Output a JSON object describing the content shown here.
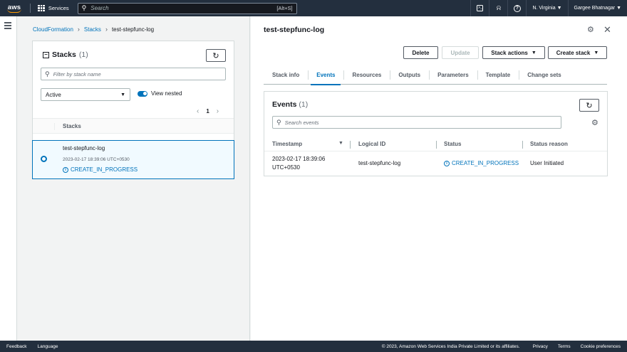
{
  "topnav": {
    "logo": "aws",
    "services_label": "Services",
    "search_placeholder": "Search",
    "search_shortcut": "[Alt+S]",
    "region": "N. Virginia",
    "user": "Gargee Bhatnagar",
    "icons": [
      "cloudshell-icon",
      "notifications-icon",
      "help-icon"
    ]
  },
  "breadcrumb": {
    "items": [
      "CloudFormation",
      "Stacks",
      "test-stepfunc-log"
    ]
  },
  "stacks_panel": {
    "title": "Stacks",
    "count": "(1)",
    "filter_placeholder": "Filter by stack name",
    "status_filter": "Active",
    "view_nested_label": "View nested",
    "view_nested_on": true,
    "page": "1",
    "column_header": "Stacks",
    "rows": [
      {
        "name": "test-stepfunc-log",
        "created": "2023-02-17 18:39:06 UTC+0530",
        "status": "CREATE_IN_PROGRESS",
        "selected": true
      }
    ]
  },
  "detail": {
    "title": "test-stepfunc-log",
    "buttons": {
      "delete": "Delete",
      "update": "Update",
      "stack_actions": "Stack actions",
      "create_stack": "Create stack"
    },
    "tabs": [
      "Stack info",
      "Events",
      "Resources",
      "Outputs",
      "Parameters",
      "Template",
      "Change sets"
    ],
    "active_tab": "Events",
    "events": {
      "title": "Events",
      "count": "(1)",
      "search_placeholder": "Search events",
      "columns": [
        "Timestamp",
        "Logical ID",
        "Status",
        "Status reason"
      ],
      "rows": [
        {
          "timestamp_line1": "2023-02-17 18:39:06",
          "timestamp_line2": "UTC+0530",
          "logical_id": "test-stepfunc-log",
          "status": "CREATE_IN_PROGRESS",
          "status_reason": "User Initiated"
        }
      ]
    }
  },
  "footer": {
    "feedback": "Feedback",
    "language": "Language",
    "copyright": "© 2023, Amazon Web Services India Private Limited or its affiliates.",
    "privacy": "Privacy",
    "terms": "Terms",
    "cookie": "Cookie preferences"
  },
  "colors": {
    "nav_bg": "#232f3e",
    "accent": "#0073bb",
    "brand_orange": "#ff9900"
  }
}
